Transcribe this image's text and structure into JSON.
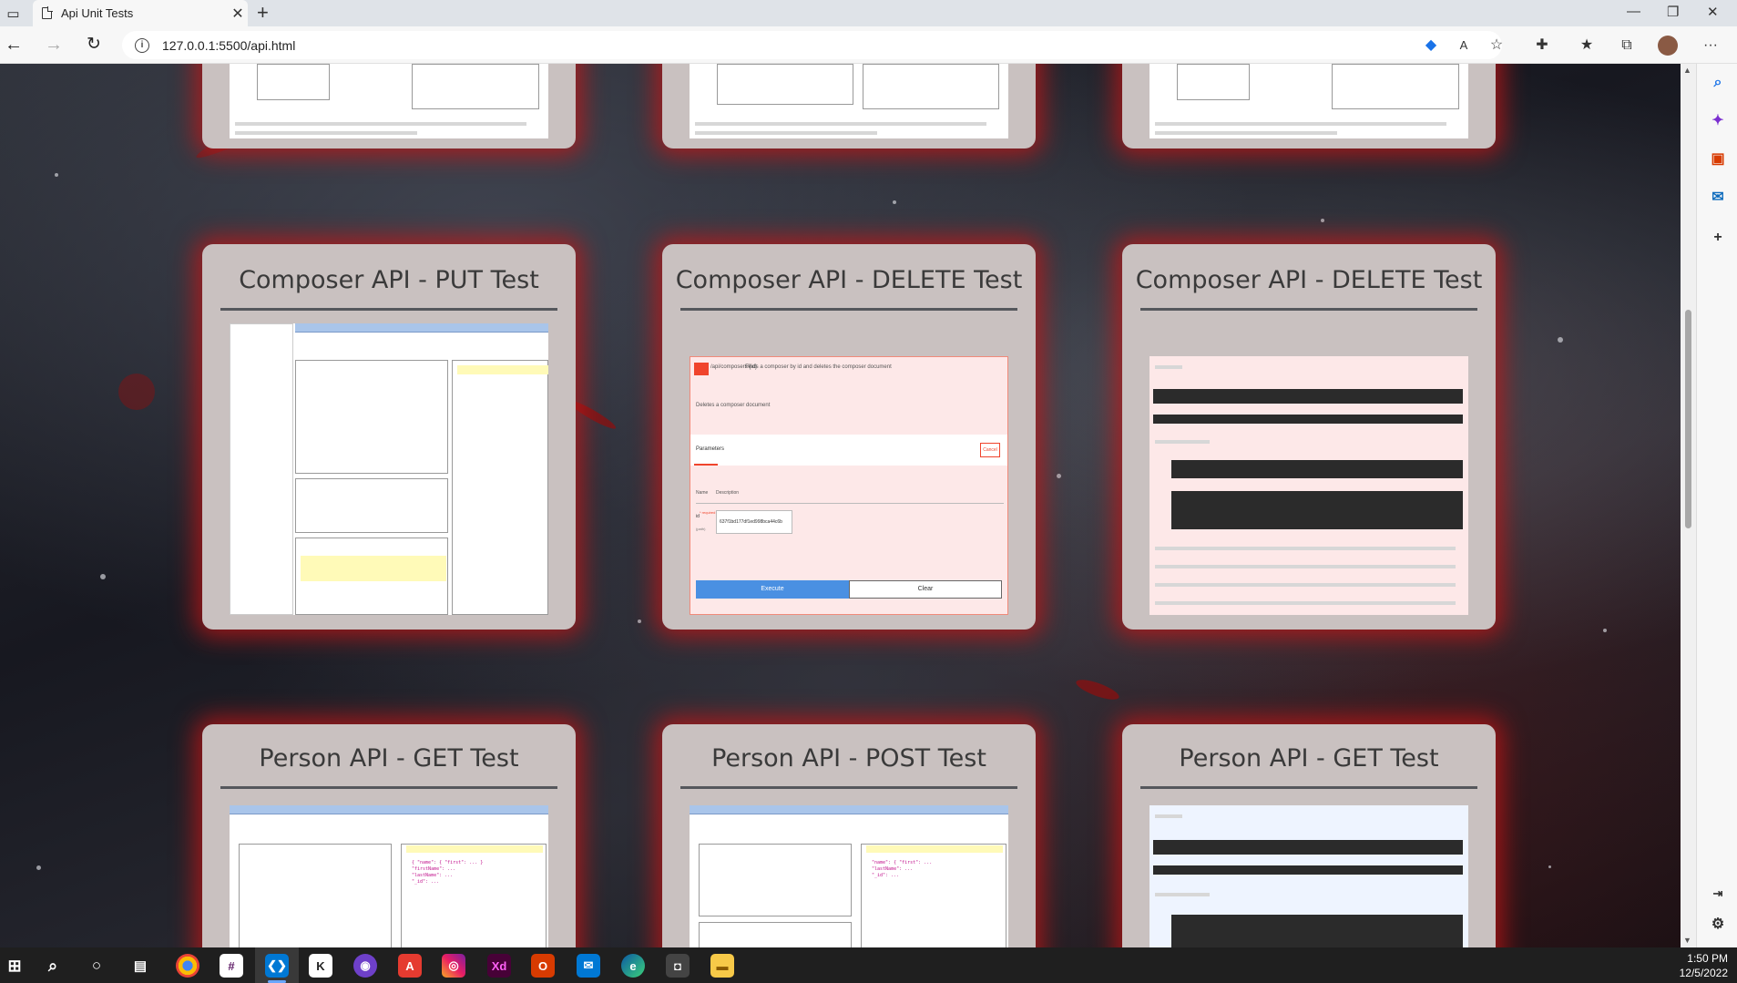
{
  "browser": {
    "tab_title": "Api Unit Tests",
    "url": "127.0.0.1:5500/api.html",
    "new_tab_glyph": "+",
    "tab_close_glyph": "✕"
  },
  "page": {
    "cards": [
      {
        "title": "Composer API - PUT Test",
        "screenshot": "soapui-put-request"
      },
      {
        "title": "Composer API - DELETE Test",
        "screenshot": "swagger-delete-form"
      },
      {
        "title": "Composer API - DELETE Test",
        "screenshot": "swagger-delete-response"
      },
      {
        "title": "Person API - GET Test",
        "screenshot": "soapui-get-request"
      },
      {
        "title": "Person API - POST Test",
        "screenshot": "soapui-post-request"
      },
      {
        "title": "Person API - GET Test",
        "screenshot": "swagger-get-response"
      }
    ],
    "delete_form": {
      "method_badge": "DELETE",
      "path": "/api/composers/{id}",
      "summary_text": "Finds a composer by id and deletes the composer document",
      "description": "Deletes a composer document",
      "parameters_tab": "Parameters",
      "cancel_label": "Cancel",
      "col_name": "Name",
      "col_description": "Description",
      "param_name": "id",
      "param_required": "* required",
      "param_type": "(path)",
      "param_value": "637f1bd177df1ed998bca44c6b",
      "execute_label": "Execute",
      "clear_label": "Clear"
    }
  },
  "taskbar": {
    "time": "1:50 PM",
    "date": "12/5/2022",
    "apps": [
      "windows-logo",
      "search-icon",
      "cortana-icon",
      "task-view-icon",
      "chrome-icon",
      "slack-icon",
      "vscode-icon",
      "kite-icon",
      "github-icon",
      "acrobat-icon",
      "instagram-icon",
      "xd-icon",
      "office-icon",
      "mail-icon",
      "edge-icon",
      "camera-icon",
      "file-explorer-icon"
    ]
  },
  "colors": {
    "card_bg": "#c9c1c0",
    "card_glow": "#c81414",
    "title_text": "#3a3a3a",
    "execute_blue": "#4a90e2",
    "delete_red": "#f0442c"
  }
}
